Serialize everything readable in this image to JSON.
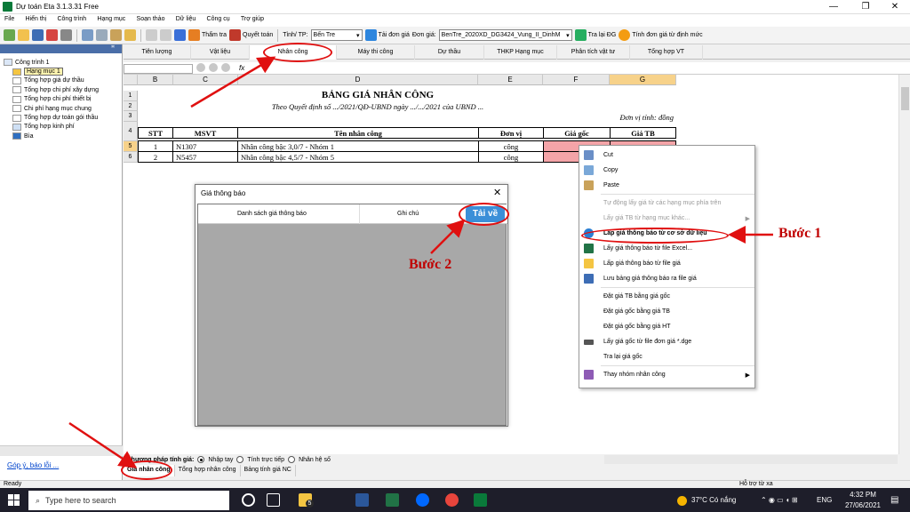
{
  "window": {
    "title": "Dự toán Eta 3.1.3.31 Free"
  },
  "menu": [
    "File",
    "Hiển thị",
    "Công trình",
    "Hạng mục",
    "Soạn thảo",
    "Dữ liệu",
    "Công cụ",
    "Trợ giúp"
  ],
  "toolbar": {
    "tham_tra": "Thẩm tra",
    "quyet_toan": "Quyết toán",
    "tinh_label": "Tỉnh/ TP:",
    "tinh_value": "Bến Tre",
    "tai_don_gia": "Tải đơn giá",
    "don_gia_label": "Đơn giá:",
    "don_gia_value": "BenTre_2020XD_DG3424_Vung_II_DinhM",
    "tra_lai_dg": "Tra lại ĐG",
    "tinh_don_gia": "Tính đơn giá từ định mức"
  },
  "sidebar": {
    "header": "ꟸ",
    "items": [
      {
        "label": "Công trình 1"
      },
      {
        "label": "Hạng mục 1"
      },
      {
        "label": "Tổng hợp giá dự thầu"
      },
      {
        "label": "Tổng hợp chi phí xây dựng"
      },
      {
        "label": "Tổng hợp chi phí thiết bị"
      },
      {
        "label": "Chi phí hạng mục chung"
      },
      {
        "label": "Tổng hợp dự toán gói thầu"
      },
      {
        "label": "Tổng hợp kinh phí"
      },
      {
        "label": "Bìa"
      }
    ],
    "feedback": "Góp ý, báo lỗi ..."
  },
  "tabs": [
    "Tiên lượng",
    "Vật liệu",
    "Nhân công",
    "Máy thi công",
    "Dự thầu",
    "THKP Hạng mục",
    "Phân tích vật tư",
    "Tổng hợp VT"
  ],
  "formula": {
    "fx": "fx"
  },
  "sheet": {
    "columns": [
      "B",
      "C",
      "D",
      "E",
      "F",
      "G"
    ],
    "rows": [
      "1",
      "2",
      "3",
      "4",
      "5",
      "6"
    ],
    "title": "BẢNG GIÁ NHÂN CÔNG",
    "subtitle": "Theo Quyết định số .../2021/QĐ-UBND ngày .../.../2021 của UBND ...",
    "unit": "Đơn vị tính: đồng",
    "headers": {
      "stt": "STT",
      "msvt": "MSVT",
      "ten": "Tên nhân công",
      "dv": "Đơn vị",
      "giagoc": "Giá gốc",
      "giatb": "Giá TB"
    },
    "data": [
      {
        "stt": "1",
        "msvt": "N1307",
        "ten": "Nhân công bậc 3,0/7 - Nhóm 1",
        "dv": "công"
      },
      {
        "stt": "2",
        "msvt": "N5457",
        "ten": "Nhân công bậc 4,5/7 - Nhóm 5",
        "dv": "công"
      }
    ]
  },
  "method": {
    "label": "Phương pháp tính giá:",
    "options": [
      "Nhập tay",
      "Tính trực tiếp",
      "Nhân hệ số"
    ]
  },
  "sheettabs": [
    "Giá nhân công",
    "Tổng hợp nhân công",
    "Bảng tính giá NC"
  ],
  "status": {
    "left": "Ready",
    "right": "Hỗ trợ từ xa"
  },
  "dialog": {
    "title": "Giá thông báo",
    "close": "✕",
    "col1": "Danh sách giá thông báo",
    "col2": "Ghi chú",
    "button": "Tải về"
  },
  "context_menu": [
    {
      "label": "Cut",
      "icon": "scissors-icon"
    },
    {
      "label": "Copy",
      "icon": "copy-icon"
    },
    {
      "label": "Paste",
      "icon": "paste-icon"
    },
    {
      "sep": true
    },
    {
      "label": "Tự động lấy giá từ các hạng mục phía trên",
      "disabled": true
    },
    {
      "label": "Lấy giá TB từ hạng mục khác...",
      "disabled": true,
      "sub": true
    },
    {
      "label": "Lấp giá thông báo từ cơ sở dữ liệu",
      "bold": true,
      "icon": "globe-icon"
    },
    {
      "label": "Lấy giá thông báo từ file Excel...",
      "icon": "excel-icon"
    },
    {
      "label": "Lấp giá thông báo từ file giá",
      "icon": "folder-icon"
    },
    {
      "label": "Lưu bảng giá thông báo ra file giá",
      "icon": "save-icon"
    },
    {
      "sep": true
    },
    {
      "label": "Đặt giá TB bằng giá gốc"
    },
    {
      "label": "Đặt giá gốc bằng giá TB"
    },
    {
      "label": "Đặt giá gốc bằng giá HT"
    },
    {
      "label": "Lấy giá gốc từ file đơn giá *.dge",
      "icon": "import-icon"
    },
    {
      "label": "Tra lại giá gốc"
    },
    {
      "sep": true
    },
    {
      "label": "Thay nhóm nhân công",
      "icon": "group-icon",
      "sub": true
    }
  ],
  "annotations": {
    "buoc1": "Bước 1",
    "buoc2": "Bước 2"
  },
  "taskbar": {
    "search": "Type here to search",
    "weather": "37°C Có nắng",
    "lang": "ENG",
    "time": "4:32 PM",
    "date": "27/06/2021",
    "badge": "5"
  },
  "colors": {
    "accent": "#e01010",
    "highlight": "#f4a4a8",
    "taskbar": "#1e1e2a"
  }
}
